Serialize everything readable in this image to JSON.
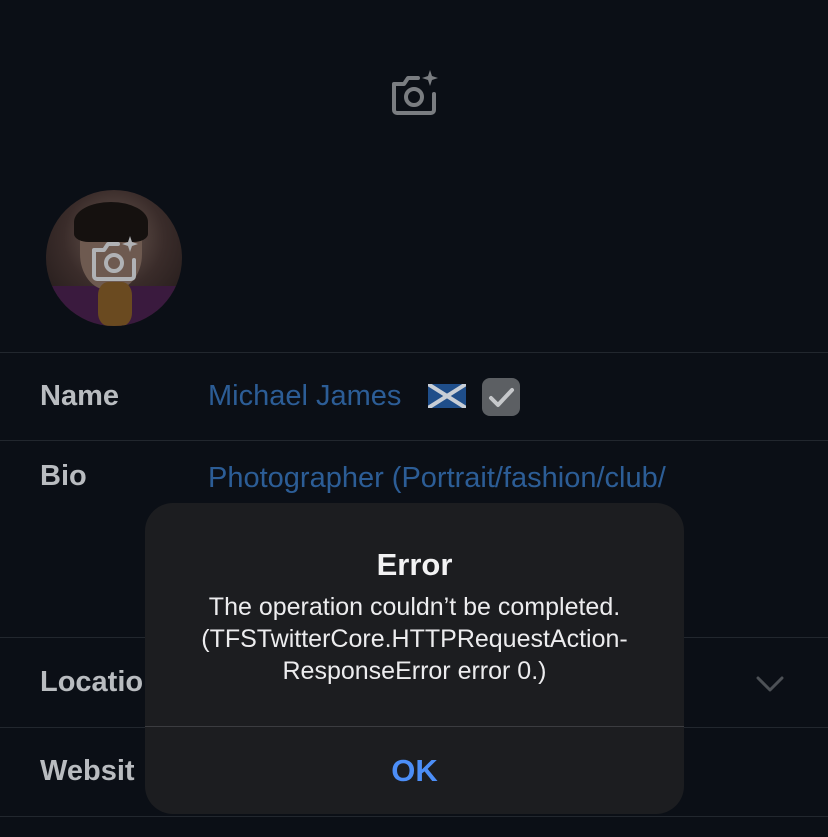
{
  "header": {
    "banner_camera_icon": "camera-add-icon"
  },
  "profile": {
    "avatar_camera_icon": "camera-add-icon"
  },
  "form": {
    "name": {
      "label": "Name",
      "value": "Michael James",
      "flag_icon": "scotland-flag-icon",
      "badge_icon": "check-mark-icon"
    },
    "bio": {
      "label": "Bio",
      "value": "Photographer (Portrait/fashion/club/"
    },
    "location": {
      "label": "Locatio",
      "chevron_icon": "chevron-down-icon"
    },
    "website": {
      "label": "Websit"
    }
  },
  "alert": {
    "title": "Error",
    "message_line1": "The operation couldn’t be completed.",
    "message_line2": "(TFSTwitterCore.HTTPRequestAction-",
    "message_line3": "ResponseError error 0.)",
    "ok_label": "OK"
  },
  "colors": {
    "background": "#0b0f16",
    "link_blue": "#2c5d96",
    "alert_bg": "#1c1d20",
    "ok_blue": "#4c8ef7"
  }
}
